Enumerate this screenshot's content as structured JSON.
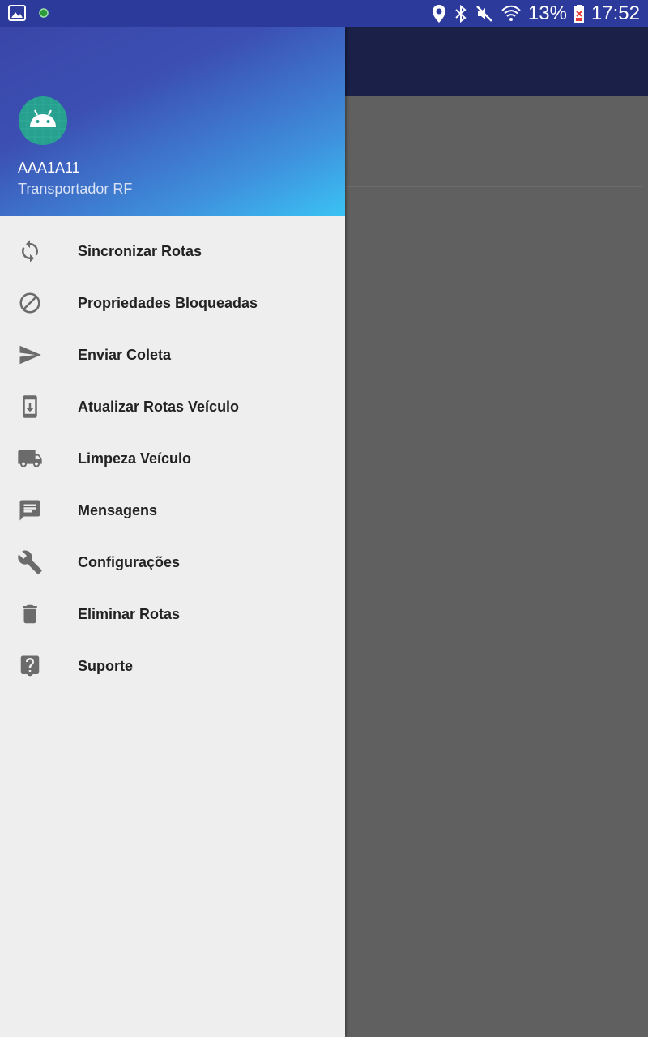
{
  "status_bar": {
    "battery_percent": "13%",
    "time": "17:52",
    "left_icons": [
      "gallery-icon",
      "green-dot-icon"
    ],
    "right_icons": [
      "location-icon",
      "bluetooth-icon",
      "mute-icon",
      "wifi-icon",
      "battery-icon"
    ]
  },
  "drawer": {
    "header": {
      "avatar_icon": "android-icon",
      "name": "AAA1A11",
      "subtitle": "Transportador RF"
    },
    "items": [
      {
        "label": "Sincronizar Rotas",
        "icon": "sync-icon"
      },
      {
        "label": "Propriedades Bloqueadas",
        "icon": "block-icon"
      },
      {
        "label": "Enviar Coleta",
        "icon": "send-icon"
      },
      {
        "label": "Atualizar Rotas Veículo",
        "icon": "phone-download-icon"
      },
      {
        "label": "Limpeza Veículo",
        "icon": "truck-icon"
      },
      {
        "label": "Mensagens",
        "icon": "message-icon"
      },
      {
        "label": "Configurações",
        "icon": "wrench-icon"
      },
      {
        "label": "Eliminar Rotas",
        "icon": "trash-icon"
      },
      {
        "label": "Suporte",
        "icon": "help-icon"
      }
    ]
  },
  "colors": {
    "status_bar": "#2c3a9c",
    "app_toolbar": "#1a2048",
    "scrim": "#606060",
    "drawer_bg": "#eeeeee",
    "icon": "#6b6b6b",
    "avatar_bg": "#27a08f"
  }
}
